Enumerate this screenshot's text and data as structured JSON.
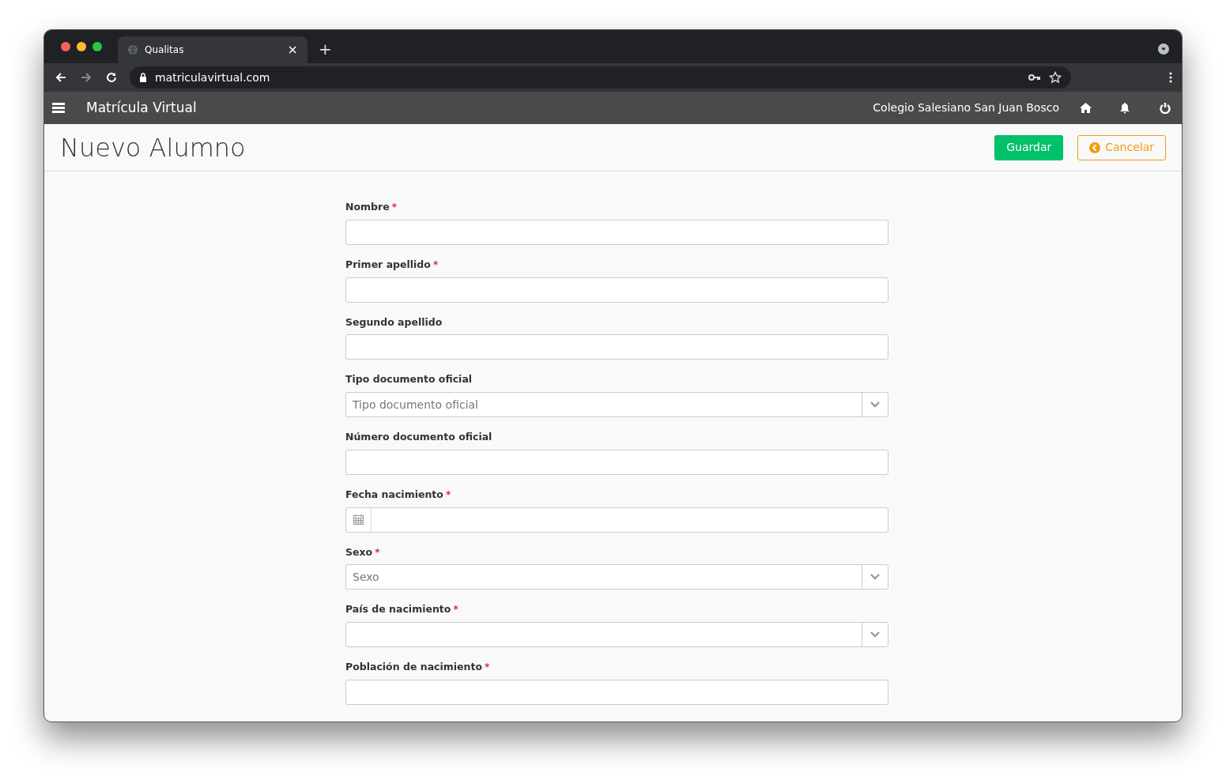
{
  "browser": {
    "tab_title": "Qualitas",
    "tab_close": "×",
    "new_tab": "+",
    "url": "matriculavirtual.com"
  },
  "navbar": {
    "app_title": "Matrícula Virtual",
    "school": "Colegio Salesiano San Juan Bosco"
  },
  "page": {
    "title": "Nuevo Alumno",
    "buttons": [
      {
        "label": "Guardar",
        "kind": "primary"
      },
      {
        "label": "Cancelar",
        "kind": "cancel"
      }
    ]
  },
  "required_mark": "*",
  "fields": [
    {
      "label": "Nombre",
      "required": true,
      "kind": "text"
    },
    {
      "label": "Primer apellido",
      "required": true,
      "kind": "text"
    },
    {
      "label": "Segundo apellido",
      "required": false,
      "kind": "text"
    },
    {
      "label": "Tipo documento oficial",
      "required": false,
      "kind": "select",
      "placeholder": "Tipo documento oficial"
    },
    {
      "label": "Número documento oficial",
      "required": false,
      "kind": "text"
    },
    {
      "label": "Fecha nacimiento",
      "required": true,
      "kind": "date"
    },
    {
      "label": "Sexo",
      "required": true,
      "kind": "select",
      "placeholder": "Sexo"
    },
    {
      "label": "País de nacimiento",
      "required": true,
      "kind": "select"
    },
    {
      "label": "Población de nacimiento",
      "required": true,
      "kind": "text"
    }
  ]
}
